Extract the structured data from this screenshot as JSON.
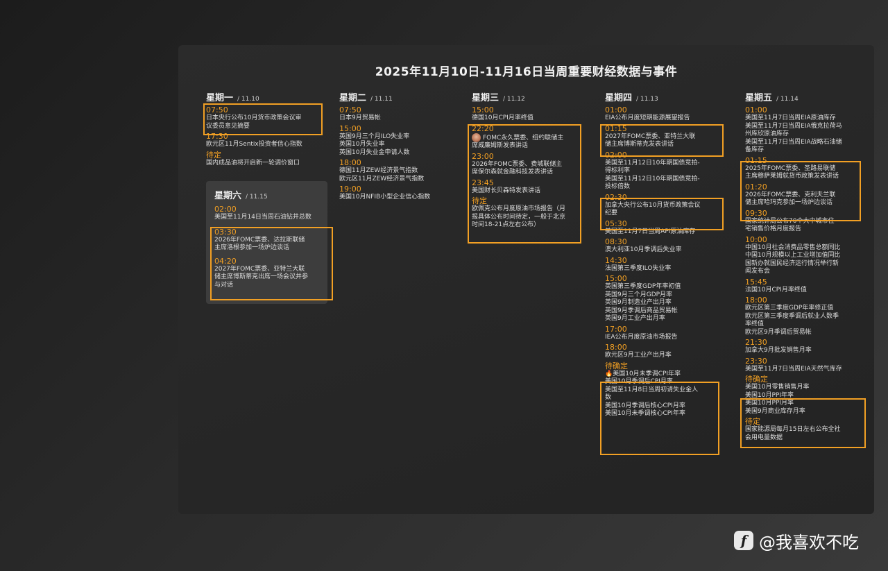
{
  "title": "2025年11月10日-11月16日当周重要财经数据与事件",
  "watermark": {
    "logo": "f",
    "name": "@我喜欢不吃"
  },
  "days": {
    "mon": {
      "name": "星期一",
      "date": "/ 11.10",
      "events": [
        {
          "time": "07:50",
          "lines": [
            "日本央行公布10月货币政策会议审",
            "议委员意见摘要"
          ]
        },
        {
          "time": "17:30",
          "lines": [
            "欧元区11月Sentix投资者信心指数"
          ]
        },
        {
          "time": "待定",
          "lines": [
            "国内成品油将开启新一轮调价窗口"
          ]
        }
      ]
    },
    "sat": {
      "name": "星期六",
      "date": "/ 11.15",
      "events": [
        {
          "time": "02:00",
          "lines": [
            "美国至11月14日当周石油钻井总数"
          ]
        },
        {
          "time": "03:30",
          "lines": [
            "2026年FOMC票委、达拉斯联储",
            "主席洛根参加一场炉边谈话"
          ]
        },
        {
          "time": "04:20",
          "lines": [
            "2027年FOMC票委、亚特兰大联",
            "储主席博斯蒂克出席一场会议并参",
            "与对话"
          ]
        }
      ]
    },
    "tue": {
      "name": "星期二",
      "date": "/ 11.11",
      "events": [
        {
          "time": "07:50",
          "lines": [
            "日本9月贸易帐"
          ]
        },
        {
          "time": "15:00",
          "lines": [
            "英国9月三个月ILO失业率",
            "英国10月失业率",
            "英国10月失业金申请人数"
          ]
        },
        {
          "time": "18:00",
          "lines": [
            "德国11月ZEW经济景气指数",
            "欧元区11月ZEW经济景气指数"
          ]
        },
        {
          "time": "19:00",
          "lines": [
            "美国10月NFIB小型企业信心指数"
          ]
        }
      ]
    },
    "wed": {
      "name": "星期三",
      "date": "/ 11.12",
      "events": [
        {
          "time": "15:00",
          "lines": [
            "德国10月CPI月率终值"
          ]
        },
        {
          "time": "22:20",
          "lines": [
            "FOMC永久票委、纽约联储主",
            "席威廉姆斯发表讲话"
          ]
        },
        {
          "time": "23:00",
          "lines": [
            "2026年FOMC票委、费城联储主",
            "席保尔森就金融科技发表讲话"
          ]
        },
        {
          "time": "23:45",
          "lines": [
            "美国财长贝森特发表讲话"
          ]
        },
        {
          "time": "待定",
          "lines": [
            "欧佩克公布月度原油市场报告（月",
            "报具体公布时间待定，一般于北京",
            "时间18-21点左右公布）"
          ]
        }
      ]
    },
    "thu": {
      "name": "星期四",
      "date": "/ 11.13",
      "events": [
        {
          "time": "01:00",
          "lines": [
            "EIA公布月度短期能源展望报告"
          ]
        },
        {
          "time": "01:15",
          "lines": [
            "2027年FOMC票委、亚特兰大联",
            "储主席博斯蒂克发表讲话"
          ]
        },
        {
          "time": "02:00",
          "lines": [
            "美国至11月12日10年期国债竞拍-",
            "得标利率",
            "美国至11月12日10年期国债竞拍-",
            "投标倍数"
          ]
        },
        {
          "time": "02:30",
          "lines": [
            "加拿大央行公布10月货币政策会议",
            "纪要"
          ]
        },
        {
          "time": "05:30",
          "lines": [
            "美国至11月7日当周API原油库存"
          ]
        },
        {
          "time": "08:30",
          "lines": [
            "澳大利亚10月季调后失业率"
          ]
        },
        {
          "time": "14:30",
          "lines": [
            "法国第三季度ILO失业率"
          ]
        },
        {
          "time": "15:00",
          "lines": [
            "英国第三季度GDP年率初值",
            "英国9月三个月GDP月率",
            "英国9月制造业产出月率",
            "英国9月季调后商品贸易帐",
            "英国9月工业产出月率"
          ]
        },
        {
          "time": "17:00",
          "lines": [
            "IEA公布月度原油市场报告"
          ]
        },
        {
          "time": "18:00",
          "lines": [
            "欧元区9月工业产出月率"
          ]
        },
        {
          "time": "待确定",
          "lines": [
            "美国10月未季调CPI年率",
            "美国10月季调后CPI月率",
            "美国至11月8日当周初请失业金人",
            "数",
            "美国10月季调后核心CPI月率",
            "美国10月未季调核心CPI年率"
          ]
        }
      ]
    },
    "fri": {
      "name": "星期五",
      "date": "/ 11.14",
      "events": [
        {
          "time": "01:00",
          "lines": [
            "美国至11月7日当周EIA原油库存",
            "美国至11月7日当周EIA俄克拉荷马",
            "州库欣原油库存",
            "美国至11月7日当周EIA战略石油储",
            "备库存"
          ]
        },
        {
          "time": "01:15",
          "lines": [
            "2025年FOMC票委、圣路易联储",
            "主席穆萨莱姆就货币政策发表讲话"
          ]
        },
        {
          "time": "01:20",
          "lines": [
            "2026年FOMC票委、克利夫兰联",
            "储主席哈玛克参加一场炉边谈话"
          ]
        },
        {
          "time": "09:30",
          "lines": [
            "国家统计局公布70个大中城市住",
            "宅销售价格月度报告"
          ]
        },
        {
          "time": "10:00",
          "lines": [
            "中国10月社会消费品零售总额同比",
            "中国10月规模以上工业增加值同比",
            "国新办就国民经济运行情况举行新",
            "闻发布会"
          ]
        },
        {
          "time": "15:45",
          "lines": [
            "法国10月CPI月率终值"
          ]
        },
        {
          "time": "18:00",
          "lines": [
            "欧元区第三季度GDP年率修正值",
            "欧元区第三季度季调后就业人数季",
            "率终值",
            "欧元区9月季调后贸易帐"
          ]
        },
        {
          "time": "21:30",
          "lines": [
            "加拿大9月批发销售月率"
          ]
        },
        {
          "time": "23:30",
          "lines": [
            "美国至11月7日当周EIA天然气库存"
          ]
        },
        {
          "time": "待确定",
          "lines": [
            "美国10月零售销售月率",
            "美国10月PPI年率",
            "美国10月PPI月率",
            "美国9月商业库存月率"
          ]
        },
        {
          "time": "待定",
          "lines": [
            "国家能源局每月15日左右公布全社",
            "会用电量数据"
          ]
        }
      ]
    }
  }
}
